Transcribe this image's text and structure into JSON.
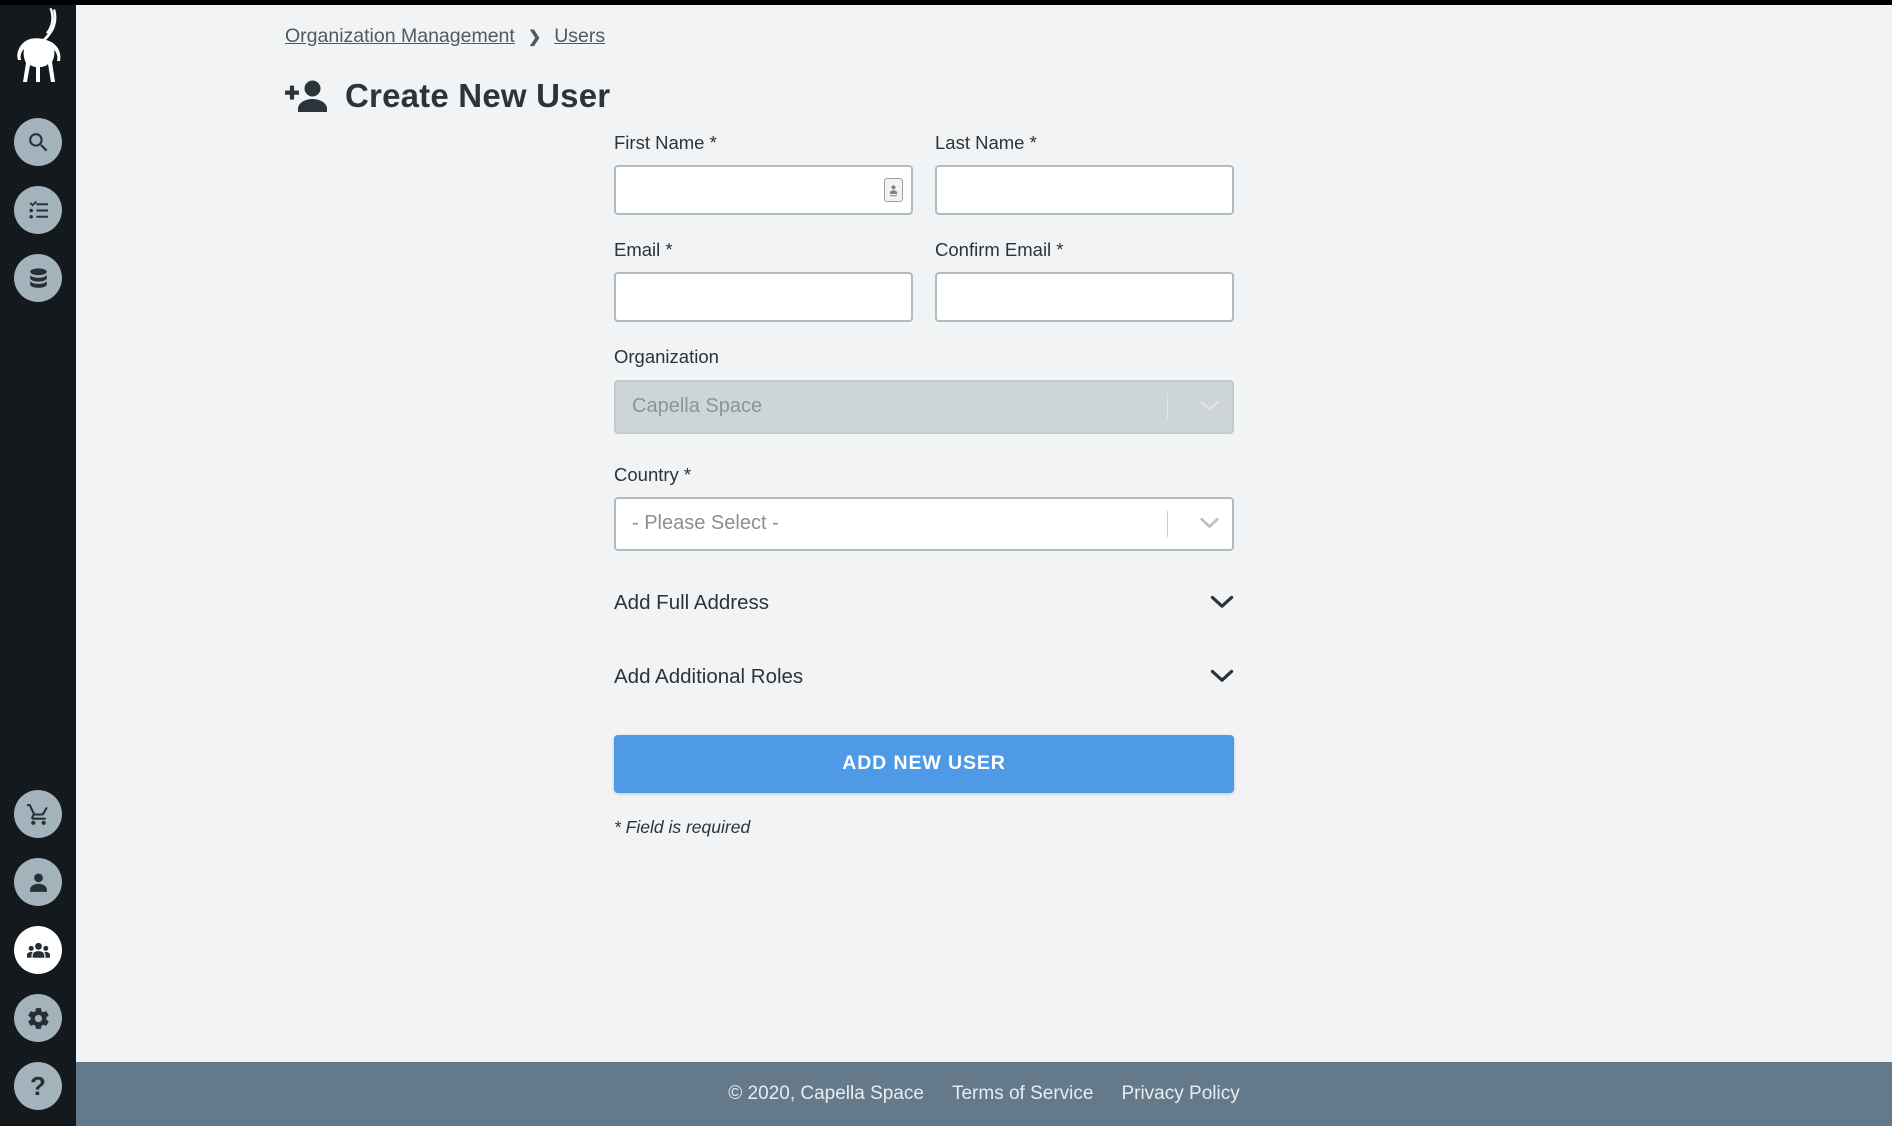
{
  "theme": {
    "sidebar_bg": "#13191c",
    "content_bg": "#f1f3f4",
    "icon_circle": "#a4b2bb",
    "icon_circle_active": "#ffffff",
    "accent_button": "#4e9ae6",
    "footer_bg": "#64798a",
    "input_border": "#b0bcc4",
    "disabled_field_bg": "#ced5d9",
    "text_primary": "#2b343a",
    "placeholder": "#878f94"
  },
  "sidebar": {
    "logo_name": "capella-ibex-logo",
    "top_items": [
      {
        "name": "search-icon",
        "label": "Search"
      },
      {
        "name": "tasking-list-icon",
        "label": "Tasking"
      },
      {
        "name": "database-icon",
        "label": "Collections"
      }
    ],
    "bottom_items": [
      {
        "name": "cart-icon",
        "label": "Cart",
        "active": false
      },
      {
        "name": "user-icon",
        "label": "Account",
        "active": false
      },
      {
        "name": "users-group-icon",
        "label": "Organization Management",
        "active": true
      },
      {
        "name": "gear-icon",
        "label": "Settings",
        "active": false
      },
      {
        "name": "help-question-icon",
        "label": "Help",
        "active": false
      }
    ]
  },
  "breadcrumb": {
    "parent": "Organization Management",
    "separator": "❯",
    "current": "Users"
  },
  "page": {
    "title": "Create New User",
    "title_icon": "add-user-icon"
  },
  "form": {
    "first_name": {
      "label": "First Name *",
      "value": "",
      "placeholder": ""
    },
    "last_name": {
      "label": "Last Name *",
      "value": "",
      "placeholder": ""
    },
    "email": {
      "label": "Email *",
      "value": "",
      "placeholder": ""
    },
    "confirm_email": {
      "label": "Confirm Email *",
      "value": "",
      "placeholder": ""
    },
    "organization": {
      "label": "Organization",
      "value": "Capella Space",
      "disabled": true
    },
    "country": {
      "label": "Country *",
      "value": "- Please Select -",
      "disabled": false
    },
    "accordions": [
      {
        "label": "Add Full Address",
        "icon": "chevron-down-icon",
        "expanded": false
      },
      {
        "label": "Add Additional Roles",
        "icon": "chevron-down-icon",
        "expanded": false
      }
    ],
    "submit_label": "ADD NEW USER",
    "required_note": "* Field is required"
  },
  "footer": {
    "copyright": "© 2020, Capella Space",
    "terms": "Terms of Service",
    "privacy": "Privacy Policy"
  }
}
